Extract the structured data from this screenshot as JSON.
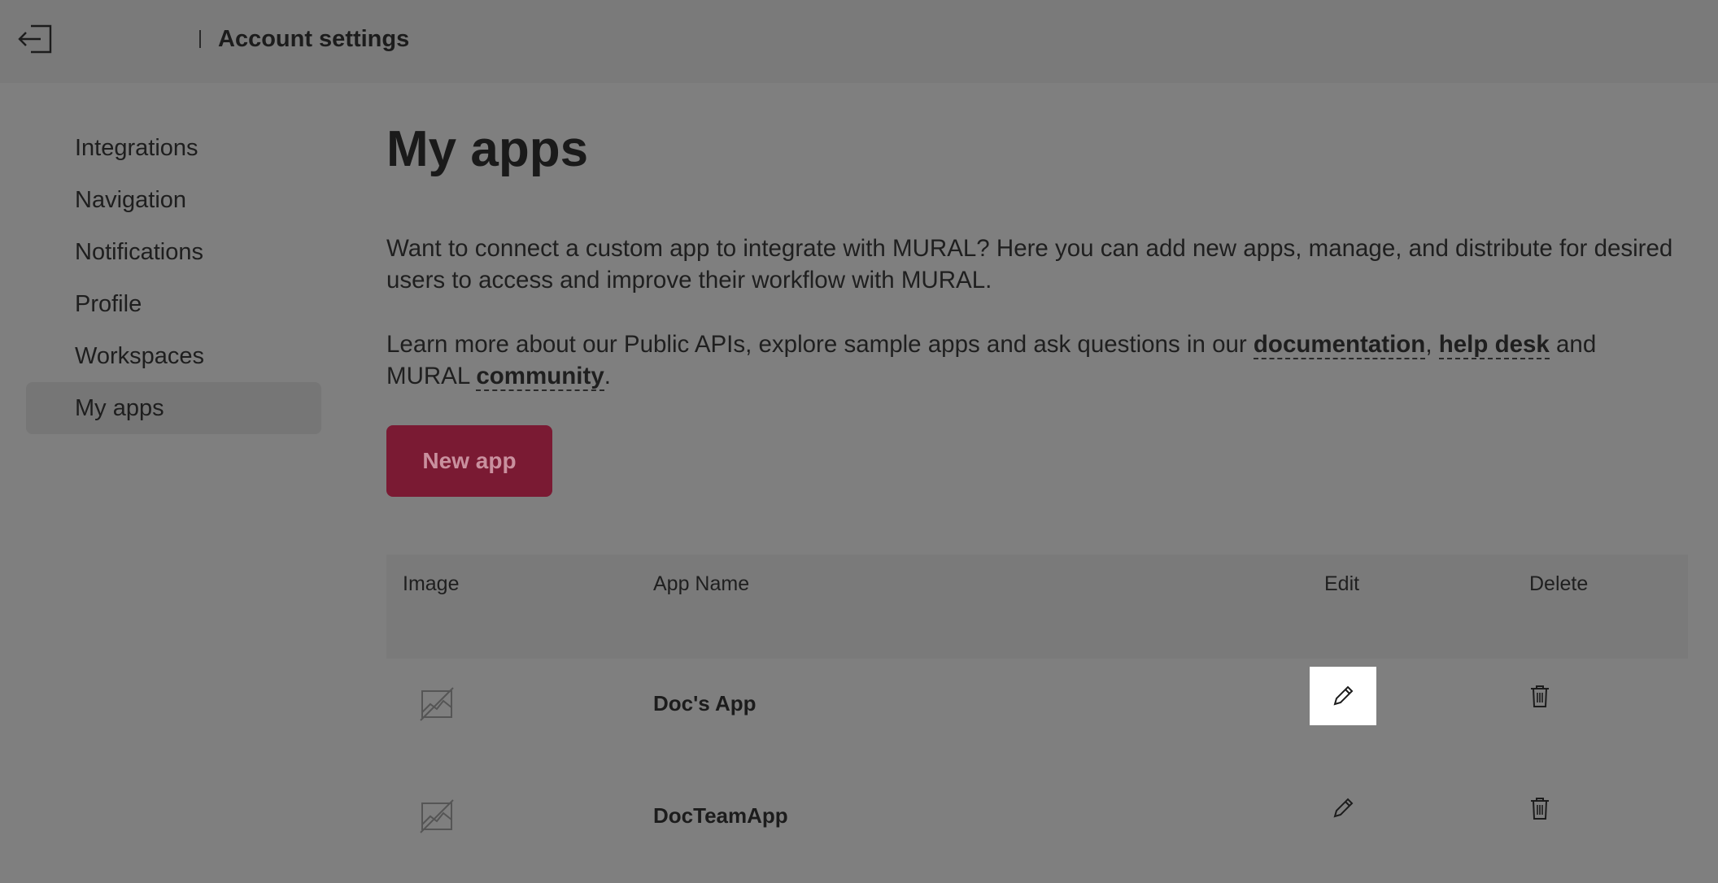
{
  "header": {
    "title": "Account settings",
    "back_icon": "exit-arrow-icon"
  },
  "sidebar": {
    "items": [
      {
        "label": "Integrations",
        "active": false
      },
      {
        "label": "Navigation",
        "active": false
      },
      {
        "label": "Notifications",
        "active": false
      },
      {
        "label": "Profile",
        "active": false
      },
      {
        "label": "Workspaces",
        "active": false
      },
      {
        "label": "My apps",
        "active": true
      }
    ]
  },
  "main": {
    "title": "My apps",
    "intro": "Want to connect a custom app to integrate with MURAL? Here you can add new apps, manage, and distribute for desired users to access and improve their workflow with MURAL.",
    "learn_prefix": "Learn more about our Public APIs, explore sample apps and ask questions in our ",
    "link_documentation": "documentation",
    "sep_comma": ", ",
    "link_help_desk": "help desk",
    "sep_and": " and MURAL ",
    "link_community": "community",
    "period": ".",
    "new_app_label": "New app",
    "new_app_color": "#7a1a33"
  },
  "table": {
    "headers": {
      "image": "Image",
      "name": "App Name",
      "edit": "Edit",
      "delete": "Delete"
    },
    "rows": [
      {
        "name": "Doc's App",
        "image_icon": "image-placeholder-icon",
        "edit_focused": true
      },
      {
        "name": "DocTeamApp",
        "image_icon": "image-placeholder-icon",
        "edit_focused": false
      }
    ]
  }
}
